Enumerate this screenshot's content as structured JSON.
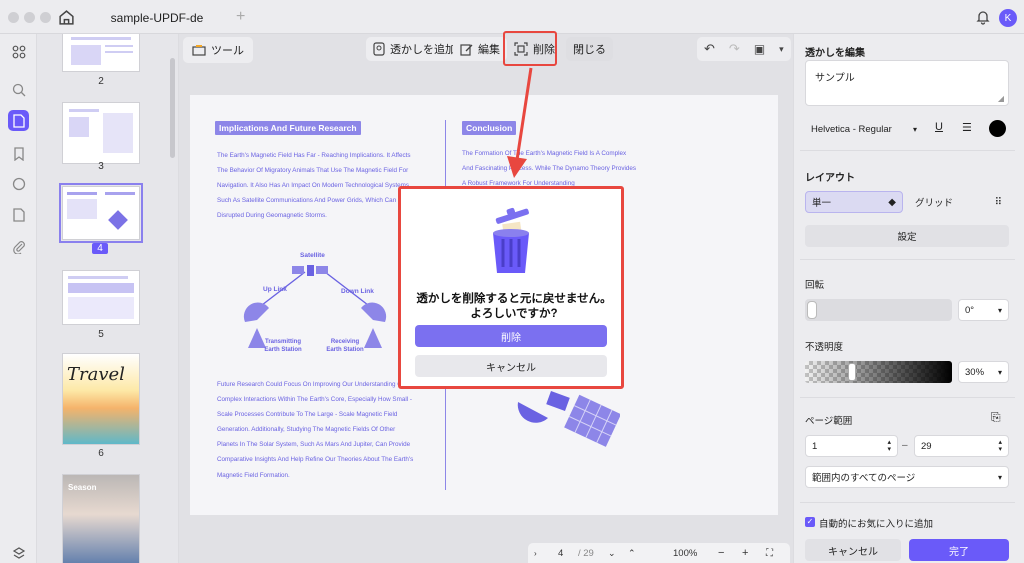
{
  "window": {
    "tab_title": "sample-UPDF-de",
    "avatar_letter": "K"
  },
  "thumbnails": [
    {
      "page": "2"
    },
    {
      "page": "3"
    },
    {
      "page": "4"
    },
    {
      "page": "5"
    },
    {
      "page": "6"
    }
  ],
  "thumb_content": {
    "travel_title": "Travel",
    "season_title": "Season"
  },
  "toolbar": {
    "tools_label": "ツール",
    "add_watermark": "透かしを追加",
    "edit": "編集",
    "delete": "削除",
    "close": "閉じる"
  },
  "page": {
    "left_heading": "Implications And Future Research",
    "left_paragraph": "The Earth's Magnetic Field Has Far - Reaching Implications. It Affects The Behavior Of Migratory Animals That Use The Magnetic Field For Navigation. It Also Has An Impact On Modern Technological Systems, Such As Satellite Communications And Power Grids, Which Can Be Disrupted During Geomagnetic Storms.",
    "diagram": {
      "satellite": "Satellite",
      "uplink": "Up Link",
      "downlink": "Down Link",
      "transmitting": "Transmitting\nEarth Station",
      "receiving": "Receiving\nEarth Station"
    },
    "left_paragraph2": "Future Research Could Focus On Improving Our Understanding Of The Complex Interactions Within The Earth's Core, Especially How Small - Scale Processes Contribute To The Large - Scale Magnetic Field Generation. Additionally, Studying The Magnetic Fields Of Other Planets In The Solar System, Such As Mars And Jupiter, Can Provide Comparative Insights And Help Refine Our Theories About The Earth's Magnetic Field Formation.",
    "right_heading": "Conclusion",
    "right_paragraph": "The Formation Of The Earth's Magnetic Field Is A Complex And Fascinating Process. While The Dynamo Theory Provides A Robust Framework For Understanding"
  },
  "dialog": {
    "message": "透かしを削除すると元に戻せません。よろしいですか?",
    "delete_button": "削除",
    "cancel_button": "キャンセル"
  },
  "right_panel": {
    "edit_title": "透かしを編集",
    "watermark_text": "サンプル",
    "font": "Helvetica - Regular",
    "layout_title": "レイアウト",
    "single": "単一",
    "grid": "グリッド",
    "settings": "設定",
    "rotation_title": "回転",
    "rotation_value": "0°",
    "opacity_title": "不透明度",
    "opacity_value": "30%",
    "opacity_level": 0.3,
    "page_range_title": "ページ範囲",
    "range_from": "1",
    "range_sep": "–",
    "range_to": "29",
    "range_option": "範囲内のすべてのページ",
    "auto_fav": "自動的にお気に入りに追加",
    "cancel": "キャンセル",
    "done": "完了"
  },
  "bottom": {
    "page_current": "4",
    "page_total": "/ 29",
    "zoom": "100%"
  },
  "colors": {
    "accent": "#6a5af9",
    "highlight": "#e8473f",
    "page_text": "#6a62e2"
  }
}
